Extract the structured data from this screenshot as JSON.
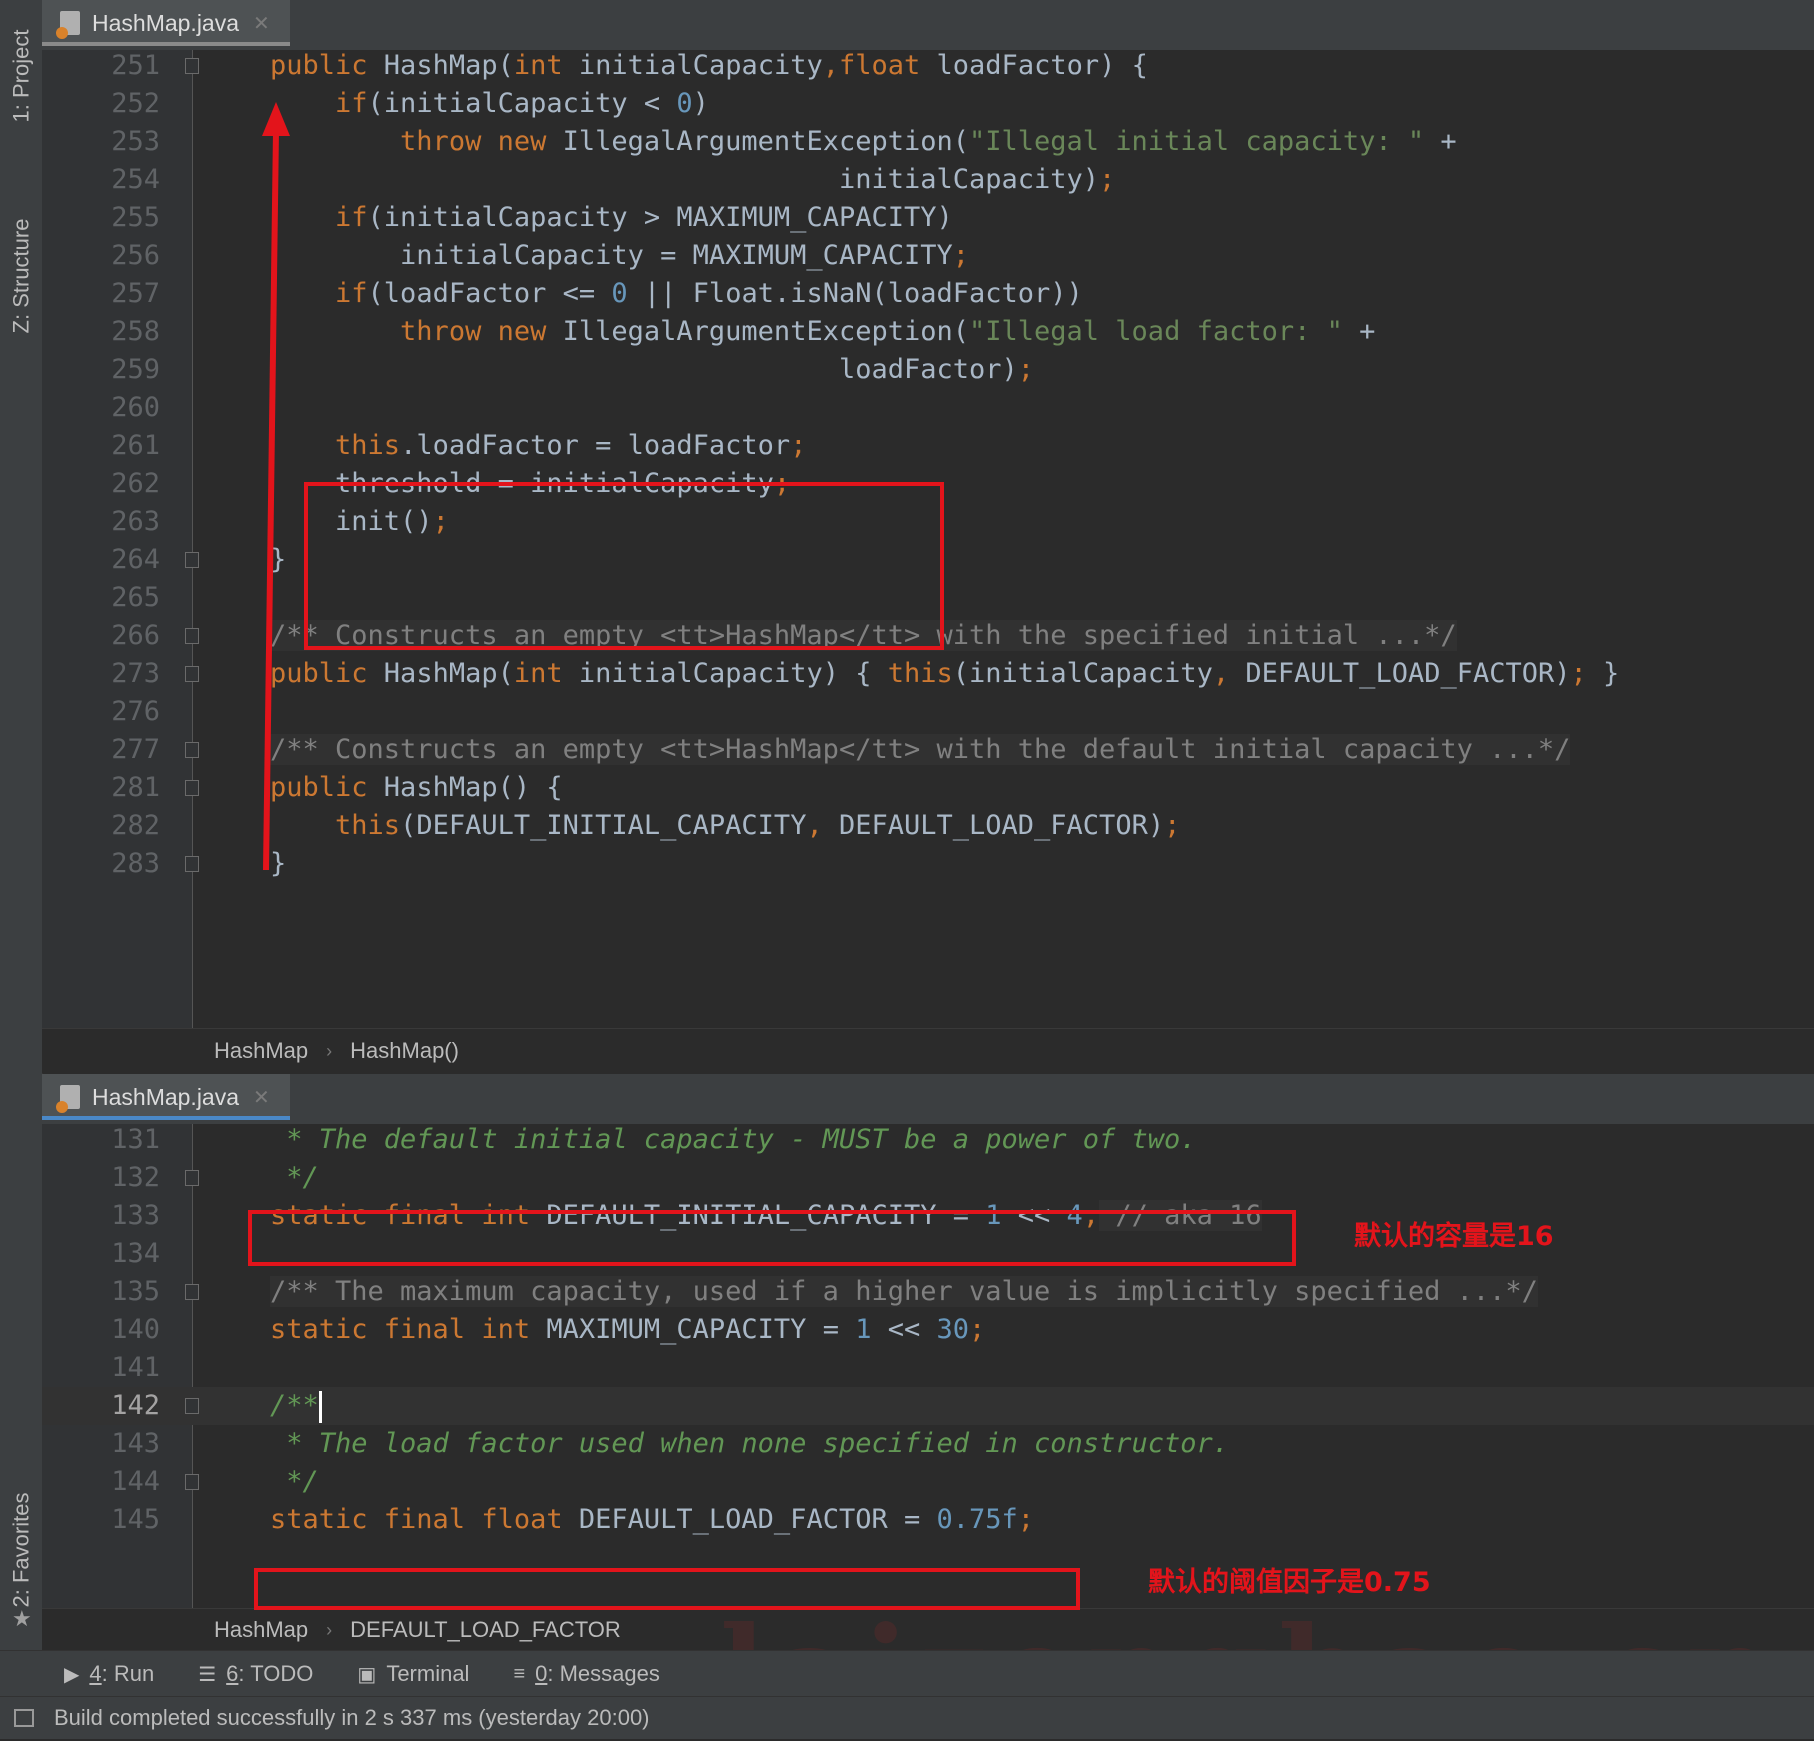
{
  "side_panels": {
    "project": "1: Project",
    "structure": "Z: Structure",
    "favorites": "2: Favorites"
  },
  "top_pane": {
    "tab_label": "HashMap.java",
    "lines": [
      {
        "n": "251",
        "code": [
          [
            "kw",
            "public"
          ],
          [
            "",
            "HashMap("
          ],
          [
            "kw",
            "int"
          ],
          [
            "",
            "initialCapacity"
          ],
          [
            "pun",
            ","
          ],
          [
            "",
            ""
          ],
          [
            "kw",
            "float"
          ],
          [
            "",
            "loadFactor) {"
          ]
        ]
      },
      {
        "n": "252",
        "code": [
          [
            "",
            "    "
          ],
          [
            "kw",
            "if"
          ],
          [
            "",
            "(initialCapacity < "
          ],
          [
            "num",
            "0"
          ],
          [
            "",
            ")"
          ]
        ]
      },
      {
        "n": "253",
        "code": [
          [
            "",
            "        "
          ],
          [
            "kw",
            "throw new"
          ],
          [
            "",
            "IllegalArgumentException("
          ],
          [
            "str",
            "\"Illegal initial capacity: \""
          ],
          [
            "",
            "+"
          ]
        ]
      },
      {
        "n": "254",
        "code": [
          [
            "",
            "                                   initialCapacity)"
          ],
          [
            "pun",
            ";"
          ]
        ]
      },
      {
        "n": "255",
        "code": [
          [
            "",
            "    "
          ],
          [
            "kw",
            "if"
          ],
          [
            "",
            "(initialCapacity > MAXIMUM_CAPACITY)"
          ]
        ]
      },
      {
        "n": "256",
        "code": [
          [
            "",
            "        initialCapacity = MAXIMUM_CAPACITY"
          ],
          [
            "pun",
            ";"
          ]
        ]
      },
      {
        "n": "257",
        "code": [
          [
            "",
            "    "
          ],
          [
            "kw",
            "if"
          ],
          [
            "",
            "(loadFactor <= "
          ],
          [
            "num",
            "0"
          ],
          [
            "",
            "|| Float.isNaN(loadFactor))"
          ]
        ]
      },
      {
        "n": "258",
        "code": [
          [
            "",
            "        "
          ],
          [
            "kw",
            "throw new"
          ],
          [
            "",
            "IllegalArgumentException("
          ],
          [
            "str",
            "\"Illegal load factor: \""
          ],
          [
            "",
            "+"
          ]
        ]
      },
      {
        "n": "259",
        "code": [
          [
            "",
            "                                   loadFactor)"
          ],
          [
            "pun",
            ";"
          ]
        ]
      },
      {
        "n": "260",
        "code": []
      },
      {
        "n": "261",
        "code": [
          [
            "",
            "    "
          ],
          [
            "kw",
            "this"
          ],
          [
            "",
            ".loadFactor = loadFactor"
          ],
          [
            "pun",
            ";"
          ]
        ]
      },
      {
        "n": "262",
        "code": [
          [
            "",
            "    threshold = initialCapacity"
          ],
          [
            "pun",
            ";"
          ]
        ]
      },
      {
        "n": "263",
        "code": [
          [
            "",
            "    init()"
          ],
          [
            "pun",
            ";"
          ]
        ]
      },
      {
        "n": "264",
        "code": [
          [
            "",
            "}"
          ]
        ]
      },
      {
        "n": "265",
        "code": []
      },
      {
        "n": "266",
        "code": [
          [
            "cm",
            "/** Constructs an empty <tt>HashMap</tt> with the specified initial ...*/"
          ]
        ]
      },
      {
        "n": "273",
        "code": [
          [
            "kw",
            "public"
          ],
          [
            "",
            "HashMap("
          ],
          [
            "kw",
            "int"
          ],
          [
            "",
            "initialCapacity) { "
          ],
          [
            "kw",
            "this"
          ],
          [
            "",
            "(initialCapacity"
          ],
          [
            "pun",
            ","
          ],
          [
            "",
            "DEFAULT_LOAD_FACTOR)"
          ],
          [
            "pun",
            ";"
          ],
          [
            "",
            "}"
          ]
        ]
      },
      {
        "n": "276",
        "code": []
      },
      {
        "n": "277",
        "code": [
          [
            "cm",
            "/** Constructs an empty <tt>HashMap</tt> with the default initial capacity ...*/"
          ]
        ]
      },
      {
        "n": "281",
        "code": [
          [
            "kw",
            "public"
          ],
          [
            "",
            "HashMap() {"
          ]
        ]
      },
      {
        "n": "282",
        "code": [
          [
            "",
            "    "
          ],
          [
            "kw",
            "this"
          ],
          [
            "",
            "(DEFAULT_INITIAL_CAPACITY"
          ],
          [
            "pun",
            ","
          ],
          [
            "",
            "DEFAULT_LOAD_FACTOR)"
          ],
          [
            "pun",
            ";"
          ]
        ]
      },
      {
        "n": "283",
        "code": [
          [
            "",
            "}"
          ]
        ]
      }
    ],
    "breadcrumb": [
      "HashMap",
      "HashMap()"
    ]
  },
  "bottom_pane": {
    "tab_label": "HashMap.java",
    "lines": [
      {
        "n": "131",
        "code": [
          [
            "cmg",
            " * The default initial capacity - MUST be a power of two."
          ]
        ]
      },
      {
        "n": "132",
        "code": [
          [
            "cmg",
            " */"
          ]
        ]
      },
      {
        "n": "133",
        "code": [
          [
            "kw",
            "static final int"
          ],
          [
            "",
            "DEFAULT_INITIAL_CAPACITY = "
          ],
          [
            "num",
            "1"
          ],
          [
            "",
            "<< "
          ],
          [
            "num",
            "4"
          ],
          [
            "pun",
            ";"
          ],
          [
            "cm",
            "// aka 16"
          ]
        ]
      },
      {
        "n": "134",
        "code": []
      },
      {
        "n": "135",
        "code": [
          [
            "cm",
            "/** The maximum capacity, used if a higher value is implicitly specified ...*/"
          ]
        ]
      },
      {
        "n": "140",
        "code": [
          [
            "kw",
            "static final int"
          ],
          [
            "",
            "MAXIMUM_CAPACITY = "
          ],
          [
            "num",
            "1"
          ],
          [
            "",
            "<< "
          ],
          [
            "num",
            "30"
          ],
          [
            "pun",
            ";"
          ]
        ]
      },
      {
        "n": "141",
        "code": []
      },
      {
        "n": "142",
        "code": [
          [
            "cmg",
            "/**"
          ]
        ],
        "current": true
      },
      {
        "n": "143",
        "code": [
          [
            "cmg",
            " * The load factor used when none specified in constructor."
          ]
        ]
      },
      {
        "n": "144",
        "code": [
          [
            "cmg",
            " */"
          ]
        ]
      },
      {
        "n": "145",
        "code": [
          [
            "kw",
            "static final float"
          ],
          [
            "",
            "DEFAULT_LOAD_FACTOR = "
          ],
          [
            "num",
            "0.75f"
          ],
          [
            "pun",
            ";"
          ]
        ]
      }
    ],
    "breadcrumb": [
      "HashMap",
      "DEFAULT_LOAD_FACTOR"
    ]
  },
  "annotations": {
    "capacity_note": "默认的容量是16",
    "load_factor_note": "默认的阈值因子是0.75"
  },
  "tool_windows": [
    {
      "num": "4",
      "label": ": Run"
    },
    {
      "num": "6",
      "label": ": TODO"
    },
    {
      "num": "",
      "label": "Terminal"
    },
    {
      "num": "0",
      "label": ": Messages"
    }
  ],
  "status_text": "Build completed successfully in 2 s 337 ms (yesterday 20:00)",
  "watermark": "laizonghao.cn",
  "colors": {
    "keyword": "#cc7832",
    "string": "#6a8759",
    "number": "#6897bb",
    "doc_comment": "#629755",
    "annotation_red": "#e3141b",
    "active_tab_underline": "#4a88c7",
    "inactive_tab_underline": "#8a8a8a"
  }
}
